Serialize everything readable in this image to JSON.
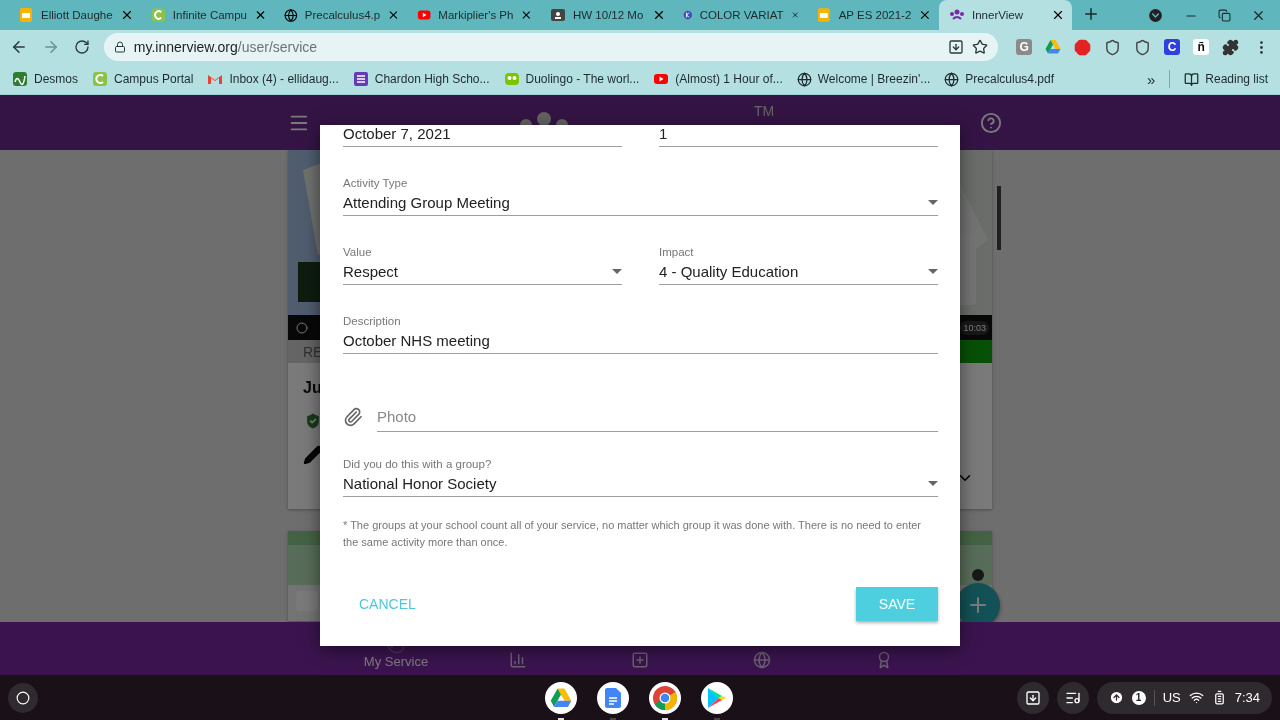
{
  "browser": {
    "tabs": [
      {
        "title": "Elliott Daughe",
        "kind": "slides",
        "selected": false
      },
      {
        "title": "Infinite Campu",
        "kind": "campus",
        "selected": false
      },
      {
        "title": "Precalculus4.p",
        "kind": "globe",
        "selected": false
      },
      {
        "title": "Markiplier's Ph",
        "kind": "youtube",
        "selected": false
      },
      {
        "title": "HW 10/12 Mo",
        "kind": "classroom",
        "selected": false
      },
      {
        "title": "COLOR VARIAT",
        "kind": "badge",
        "selected": false
      },
      {
        "title": "AP ES 2021-2",
        "kind": "slides",
        "selected": false
      },
      {
        "title": "InnerView",
        "kind": "innerview",
        "selected": true
      }
    ],
    "address": {
      "host": "my.innerview.org",
      "path": "/user/service"
    },
    "extensions": [
      {
        "kind": "letter_gray",
        "text": "G"
      },
      {
        "kind": "drive"
      },
      {
        "kind": "stop"
      },
      {
        "kind": "shield"
      },
      {
        "kind": "shield"
      },
      {
        "kind": "letter_blue",
        "text": "C"
      },
      {
        "kind": "letter_plain",
        "text": "ñ"
      },
      {
        "kind": "puzzle"
      }
    ],
    "bookmarks": [
      {
        "label": "Desmos",
        "kind": "desmos"
      },
      {
        "label": "Campus Portal",
        "kind": "campus"
      },
      {
        "label": "Inbox (4) - ellidaug...",
        "kind": "gmail"
      },
      {
        "label": "Chardon High Scho...",
        "kind": "list"
      },
      {
        "label": "Duolingo - The worl...",
        "kind": "owl"
      },
      {
        "label": "(Almost) 1 Hour of...",
        "kind": "youtube"
      },
      {
        "label": "Welcome | Breezin'...",
        "kind": "globe"
      },
      {
        "label": "Precalculus4.pdf",
        "kind": "globe"
      }
    ],
    "more": "»",
    "reading_list": "Reading list"
  },
  "app": {
    "logo_mark": "TM",
    "card": {
      "time": "10:03",
      "status": "RE",
      "title": "Ju"
    },
    "bottom_nav": [
      {
        "kind": "service",
        "label": "My Service",
        "selected": true
      },
      {
        "kind": "chart",
        "selected": false
      },
      {
        "kind": "add",
        "selected": false
      },
      {
        "kind": "globe",
        "selected": false
      },
      {
        "kind": "star",
        "selected": false
      }
    ]
  },
  "dialog": {
    "rows": [
      [
        {
          "kind": "text",
          "value": "October 7, 2021"
        },
        {
          "kind": "text",
          "value": "1"
        }
      ],
      [
        {
          "kind": "select",
          "label": "Activity Type",
          "value": "Attending Group Meeting"
        }
      ],
      [
        {
          "kind": "select",
          "label": "Value",
          "value": "Respect"
        },
        {
          "kind": "select",
          "label": "Impact",
          "value": "4 - Quality Education"
        }
      ],
      [
        {
          "kind": "text",
          "label": "Description",
          "value": "October NHS meeting"
        }
      ],
      [
        {
          "kind": "attachment",
          "placeholder": "Photo"
        }
      ],
      [
        {
          "kind": "select",
          "label": "Did you do this with a group?",
          "value": "National Honor Society"
        }
      ]
    ],
    "note": "* The groups at your school count all of your service, no matter which group it was done with. There is no need to enter the same activity more than once.",
    "cancel": "CANCEL",
    "save": "SAVE"
  },
  "shelf": {
    "apps": [
      {
        "kind": "drive",
        "running": true
      },
      {
        "kind": "docs",
        "running": false
      },
      {
        "kind": "chrome",
        "running": true
      },
      {
        "kind": "play",
        "running": false
      }
    ],
    "notifications": "1",
    "ime": "US",
    "time": "7:34"
  }
}
